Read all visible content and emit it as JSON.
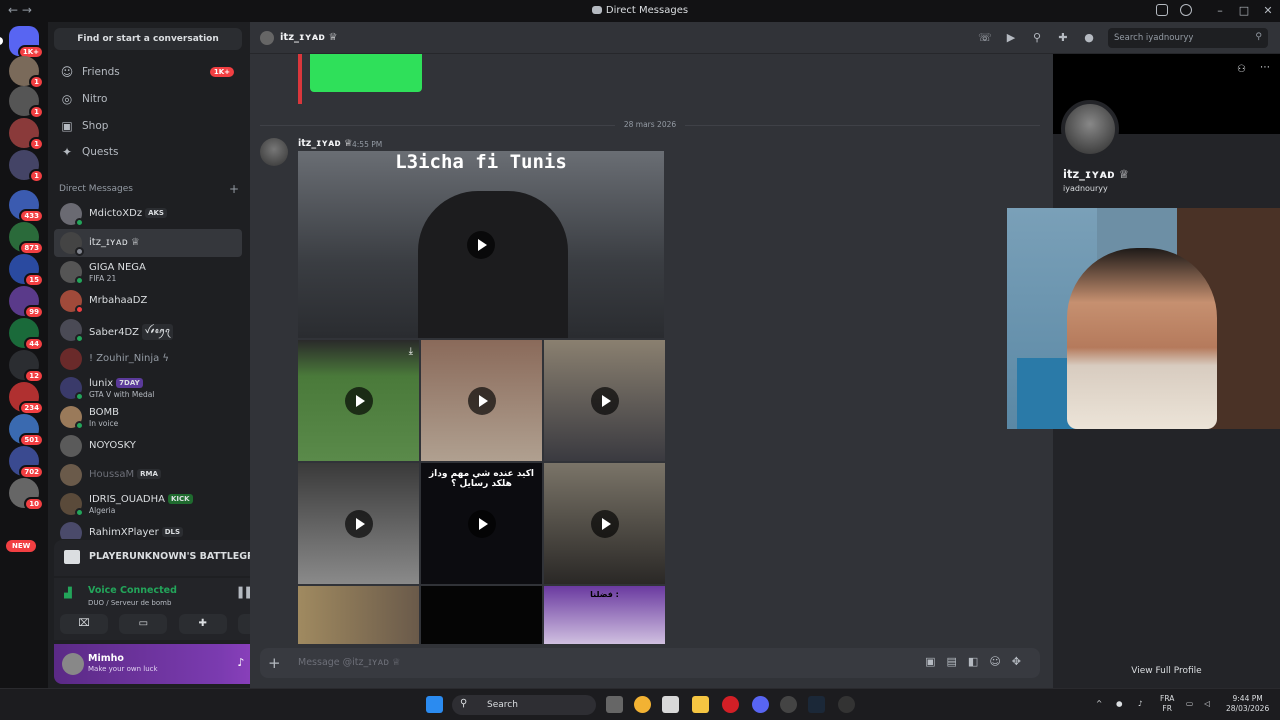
{
  "window": {
    "title": "Direct Messages",
    "nav_back": "←",
    "nav_fwd": "→",
    "min": "–",
    "max": "□",
    "close": "✕"
  },
  "servers": {
    "badges": [
      "1K+",
      "1",
      "1",
      "1",
      "1",
      "433",
      "873",
      "15",
      "99",
      "44",
      "12",
      "234",
      "501",
      "702",
      "10"
    ],
    "new_label": "NEW"
  },
  "sidebar": {
    "search": "Find or start a conversation",
    "nav": [
      {
        "label": "Friends",
        "icon": "person-wave-icon",
        "badge": "1K+"
      },
      {
        "label": "Nitro",
        "icon": "nitro-icon"
      },
      {
        "label": "Shop",
        "icon": "shop-icon"
      },
      {
        "label": "Quests",
        "icon": "compass-icon"
      }
    ],
    "dm_header": "Direct Messages",
    "dms": [
      {
        "name": "MdictoXDz",
        "tag": "AKS",
        "sub": ""
      },
      {
        "name": "itz_ɪʏᴀᴅ ♕",
        "tag": "",
        "sub": ""
      },
      {
        "name": "GIGA NEGA",
        "tag": "",
        "sub": "FIFA 21"
      },
      {
        "name": "MrbahaaDZ",
        "tag": "",
        "sub": ""
      },
      {
        "name": "Saber4DZ",
        "tag": "ꪜ⸙ꫀꪑꪖ",
        "sub": ""
      },
      {
        "name": "! Zouhir_Ninja ϟ",
        "tag": "",
        "sub": ""
      },
      {
        "name": "lunix",
        "tag": "7DAY",
        "sub": "GTA V with Medal"
      },
      {
        "name": "BOMB",
        "tag": "",
        "sub": "In voice"
      },
      {
        "name": "NOYOSKY",
        "tag": "",
        "sub": ""
      },
      {
        "name": "HoussaM",
        "tag": "RMA",
        "sub": ""
      },
      {
        "name": "IDRIS_OUADHA",
        "tag": "KICK",
        "sub": "Algeria"
      },
      {
        "name": "RahimXPlayer",
        "tag": "DLS",
        "sub": ""
      }
    ],
    "game": "PLAYERUNKNOWN'S BATTLEGRO...",
    "voice": {
      "status": "Voice Connected",
      "server": "DUO / Serveur de bomb"
    },
    "user": {
      "name": "Mimho",
      "status": "Make your own luck"
    }
  },
  "chat": {
    "header_name": "itz_ɪʏᴀᴅ ♕",
    "search_placeholder": "Search iyadnouryy",
    "date": "28 mars 2026",
    "author": "itz_ɪʏᴀᴅ ♕",
    "time": "4:55 PM",
    "video_main_caption": "L3icha fi Tunis",
    "video_caption_a": "اكيد عنده شي مهم وداز هلكد رسايل ؟",
    "video_caption_b": "فضلنا :",
    "composer_placeholder": "Message @itz_ɪʏᴀᴅ ♕"
  },
  "profile": {
    "name": "itz_ɪʏᴀᴅ ♕",
    "username": "iyadnouryy",
    "view_full": "View Full Profile"
  },
  "taskbar": {
    "search": "Search",
    "lang1": "FRA",
    "lang2": "FR",
    "time": "9:44 PM",
    "date": "28/03/2026"
  }
}
